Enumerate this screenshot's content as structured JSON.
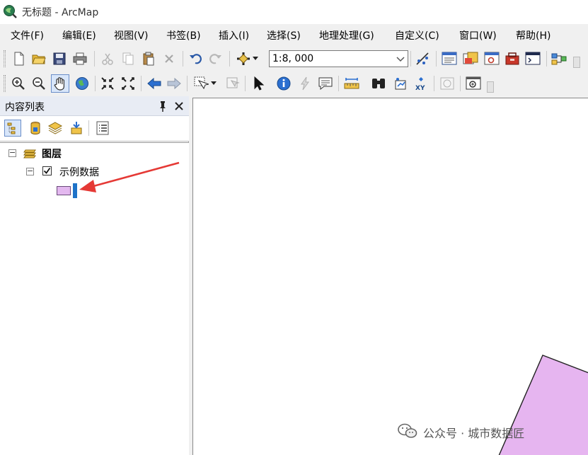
{
  "window": {
    "title": "无标题 - ArcMap"
  },
  "menu": {
    "items": [
      {
        "label": "文件(F)"
      },
      {
        "label": "编辑(E)"
      },
      {
        "label": "视图(V)"
      },
      {
        "label": "书签(B)"
      },
      {
        "label": "插入(I)"
      },
      {
        "label": "选择(S)"
      },
      {
        "label": "地理处理(G)"
      },
      {
        "label": "自定义(C)"
      },
      {
        "label": "窗口(W)"
      },
      {
        "label": "帮助(H)"
      }
    ]
  },
  "toolbar": {
    "scale_value": "1:8, 000"
  },
  "toc": {
    "title": "内容列表",
    "root_label": "图层",
    "layer_label": "示例数据",
    "layer_checked": true,
    "symbol_fill": "#e3b8ef",
    "symbol_stroke": "#6a4a7a"
  },
  "map": {
    "polygon_fill": "#e6b5f0",
    "polygon_stroke": "#222222",
    "arrow_color": "#e53935",
    "highlight_color": "#1e73c8"
  },
  "watermark": {
    "text": "公众号 · 城市数据匠"
  }
}
